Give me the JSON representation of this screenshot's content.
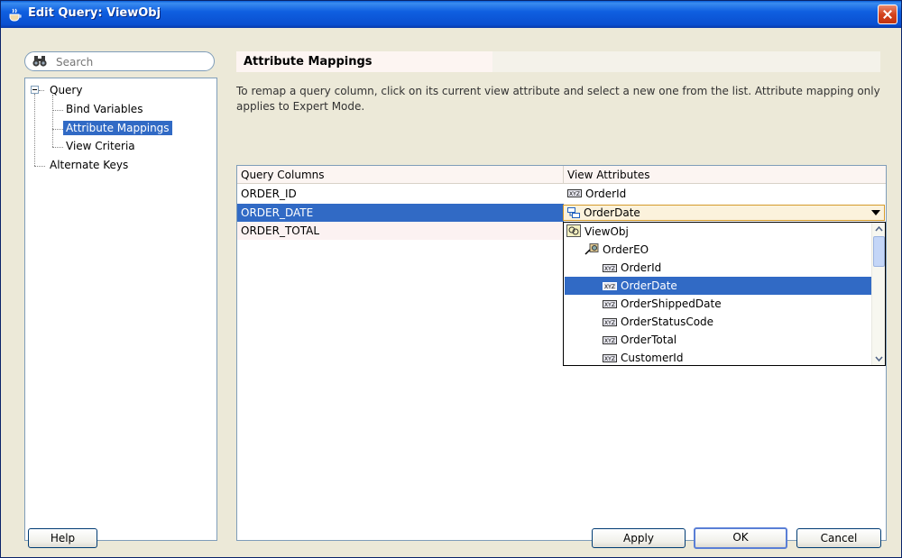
{
  "window": {
    "title": "Edit Query: ViewObj"
  },
  "search": {
    "placeholder": "Search"
  },
  "tree": {
    "items": [
      {
        "label": "Query"
      },
      {
        "label": "Bind Variables"
      },
      {
        "label": "Attribute Mappings"
      },
      {
        "label": "View Criteria"
      },
      {
        "label": "Alternate Keys"
      }
    ]
  },
  "main": {
    "title": "Attribute Mappings",
    "description": "To remap a query column, click on its current view attribute and select a new one from the list.  Attribute mapping only applies to Expert Mode."
  },
  "table": {
    "headers": [
      "Query Columns",
      "View Attributes"
    ],
    "rows": [
      {
        "column": "ORDER_ID",
        "attribute": "OrderId"
      },
      {
        "column": "ORDER_DATE",
        "attribute": "OrderDate"
      },
      {
        "column": "ORDER_TOTAL",
        "attribute": ""
      }
    ]
  },
  "dropdown": {
    "items": [
      {
        "label": "ViewObj",
        "icon": "view-object-icon"
      },
      {
        "label": "OrderEO",
        "icon": "entity-object-icon"
      },
      {
        "label": "OrderId",
        "icon": "attribute-icon"
      },
      {
        "label": "OrderDate",
        "icon": "attribute-icon"
      },
      {
        "label": "OrderShippedDate",
        "icon": "attribute-icon"
      },
      {
        "label": "OrderStatusCode",
        "icon": "attribute-icon"
      },
      {
        "label": "OrderTotal",
        "icon": "attribute-icon"
      },
      {
        "label": "CustomerId",
        "icon": "attribute-icon"
      }
    ]
  },
  "buttons": {
    "help": "Help",
    "apply": "Apply",
    "ok": "OK",
    "cancel": "Cancel"
  },
  "colors": {
    "titlebar": "#0a4fd0",
    "selection": "#316ac5",
    "dialog": "#ece9d8",
    "combo_border": "#d49a2a"
  }
}
